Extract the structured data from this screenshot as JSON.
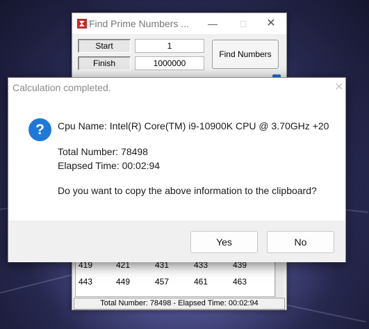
{
  "app": {
    "title": "Find Prime Numbers ...",
    "start_label": "Start",
    "start_value": "1",
    "finish_label": "Finish",
    "finish_value": "1000000",
    "find_button": "Find Numbers",
    "results": [
      [
        "419",
        "421",
        "431",
        "433",
        "439"
      ],
      [
        "443",
        "449",
        "457",
        "461",
        "463"
      ]
    ],
    "status": "Total Number: 78498  -  Elapsed Time: 00:02:94"
  },
  "dialog": {
    "title": "Calculation completed.",
    "cpu_line": "Cpu Name: Intel(R) Core(TM) i9-10900K CPU @ 3.70GHz +20",
    "total_line": "Total Number: 78498",
    "elapsed_line": "Elapsed Time: 00:02:94",
    "question": "Do you want to copy the above information to the clipboard?",
    "yes_label": "Yes",
    "no_label": "No",
    "icon": "question-icon",
    "icon_glyph": "?"
  }
}
